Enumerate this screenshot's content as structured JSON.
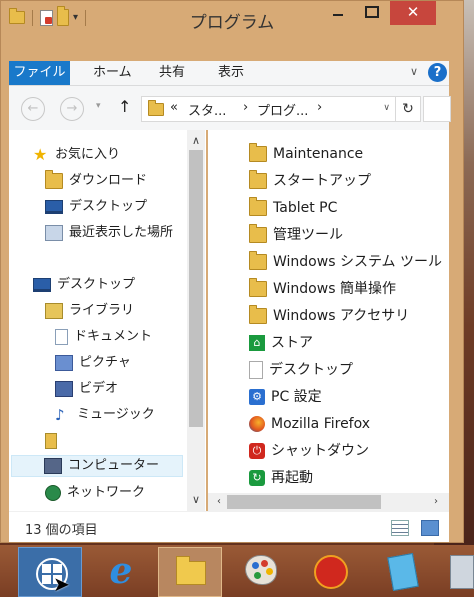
{
  "window": {
    "title": "プログラム",
    "close_glyph": "✕",
    "minimize_name": "minimize",
    "maximize_name": "maximize"
  },
  "ribbon": {
    "tabs": [
      "ファイル",
      "ホーム",
      "共有",
      "表示"
    ],
    "expand_glyph": "∨",
    "help_glyph": "?"
  },
  "navbar": {
    "back_glyph": "←",
    "forward_glyph": "→",
    "history_glyph": "▾",
    "up_glyph": "↑",
    "breadcrumb": [
      "«",
      "スタ...",
      "›",
      "プログ...",
      "›"
    ],
    "dropdown_glyph": "∨",
    "refresh_glyph": "↻"
  },
  "nav_pane": {
    "items": [
      {
        "label": "お気に入り",
        "icon": "star-icon"
      },
      {
        "label": "ダウンロード",
        "icon": "downloads-folder-icon"
      },
      {
        "label": "デスクトップ",
        "icon": "desktop-icon"
      },
      {
        "label": "最近表示した場所",
        "icon": "recent-places-icon"
      },
      {
        "label": "デスクトップ",
        "icon": "desktop-icon"
      },
      {
        "label": "ライブラリ",
        "icon": "libraries-icon"
      },
      {
        "label": "ドキュメント",
        "icon": "documents-icon"
      },
      {
        "label": "ピクチャ",
        "icon": "pictures-icon"
      },
      {
        "label": "ビデオ",
        "icon": "videos-icon"
      },
      {
        "label": "ミュージック",
        "icon": "music-icon"
      },
      {
        "label": "",
        "icon": "homegroup-icon"
      },
      {
        "label": "コンピューター",
        "icon": "computer-icon"
      },
      {
        "label": "ネットワーク",
        "icon": "network-icon"
      }
    ],
    "scroll_up": "∧",
    "scroll_down": "∨"
  },
  "files": {
    "items": [
      {
        "label": "Maintenance",
        "icon": "folder-icon"
      },
      {
        "label": "スタートアップ",
        "icon": "folder-icon"
      },
      {
        "label": "Tablet PC",
        "icon": "folder-icon"
      },
      {
        "label": "管理ツール",
        "icon": "folder-icon"
      },
      {
        "label": "Windows システム ツール",
        "icon": "folder-icon"
      },
      {
        "label": "Windows 簡単操作",
        "icon": "folder-icon"
      },
      {
        "label": "Windows アクセサリ",
        "icon": "folder-icon"
      },
      {
        "label": "ストア",
        "icon": "store-icon"
      },
      {
        "label": "デスクトップ",
        "icon": "blank-file-icon"
      },
      {
        "label": "PC 設定",
        "icon": "gear-icon"
      },
      {
        "label": "Mozilla Firefox",
        "icon": "firefox-icon"
      },
      {
        "label": "シャットダウン",
        "icon": "power-icon"
      },
      {
        "label": "再起動",
        "icon": "restart-icon"
      }
    ],
    "scroll_left": "‹",
    "scroll_right": "›"
  },
  "status": {
    "item_count": "13 個の項目"
  },
  "taskbar": {
    "ie_glyph": "e"
  },
  "colors": {
    "accent": "#1979ca",
    "close": "#c7463d",
    "frame": "#d7aa76"
  }
}
